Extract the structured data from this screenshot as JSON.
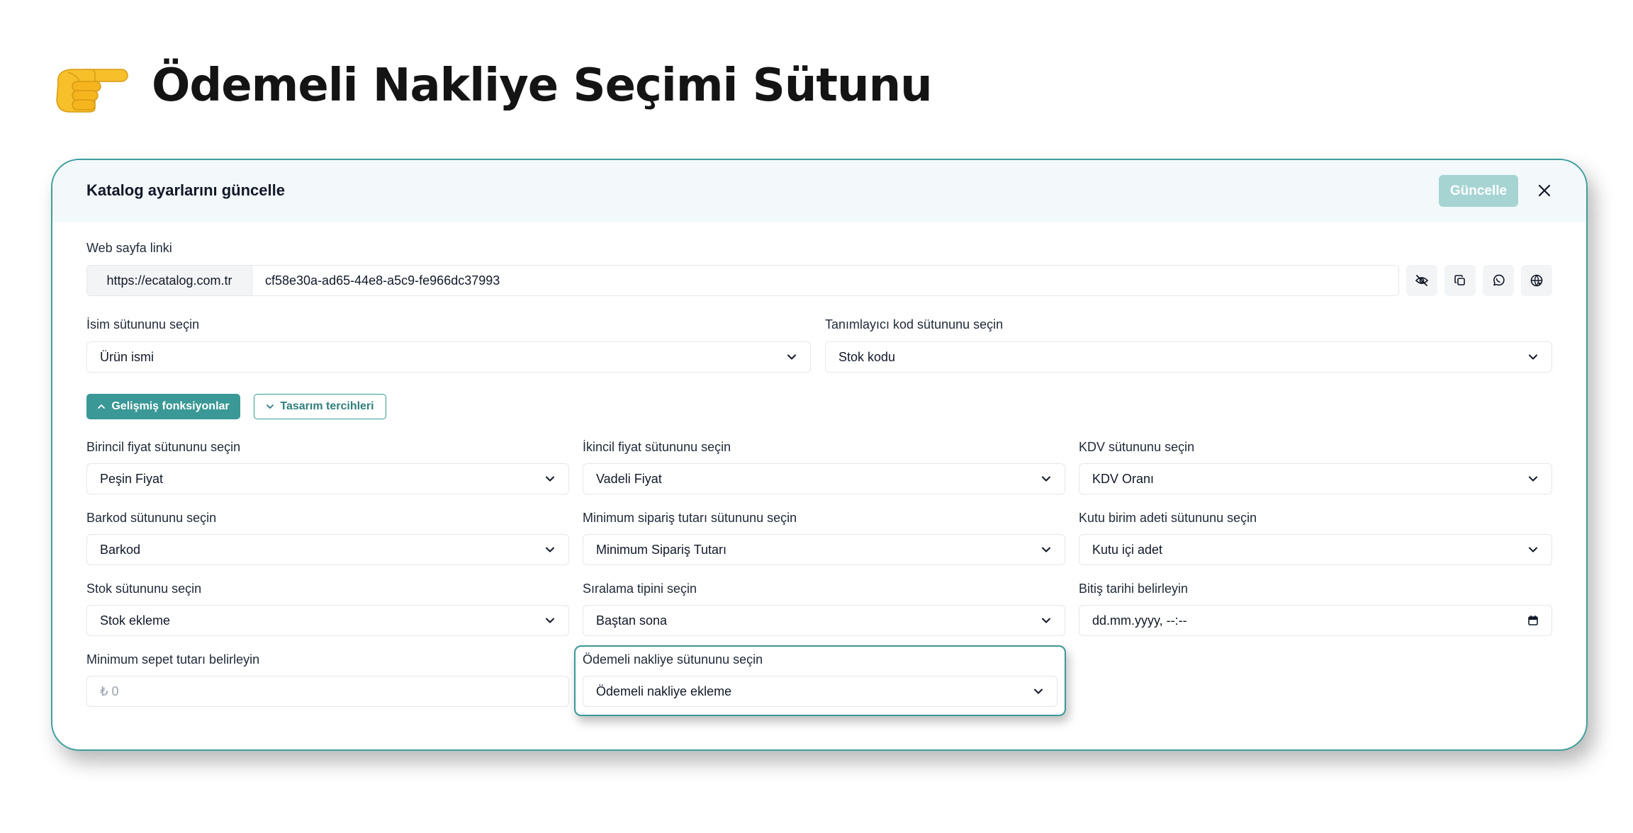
{
  "heading": {
    "icon": "pointing-hand-icon",
    "title": "Ödemeli Nakliye Seçimi Sütunu"
  },
  "dialog": {
    "title": "Katalog ayarlarını güncelle",
    "update_label": "Güncelle",
    "close_icon": "close-icon",
    "web_link": {
      "label": "Web sayfa linki",
      "prefix": "https://ecatalog.com.tr",
      "value": "cf58e30a-ad65-44e8-a5c9-fe966dc37993",
      "actions": [
        "eye-off-icon",
        "copy-icon",
        "whatsapp-icon",
        "globe-icon"
      ]
    },
    "name_column": {
      "label": "İsim sütununu seçin",
      "value": "Ürün ismi"
    },
    "id_column": {
      "label": "Tanımlayıcı kod sütununu seçin",
      "value": "Stok kodu"
    },
    "tabs": {
      "advanced": "Gelişmiş fonksiyonlar",
      "design": "Tasarım tercihleri"
    },
    "fields": {
      "primary_price": {
        "label": "Birincil fiyat sütununu seçin",
        "value": "Peşin Fiyat"
      },
      "secondary_price": {
        "label": "İkincil fiyat sütununu seçin",
        "value": "Vadeli Fiyat"
      },
      "vat": {
        "label": "KDV sütununu seçin",
        "value": "KDV Oranı"
      },
      "barcode": {
        "label": "Barkod sütununu seçin",
        "value": "Barkod"
      },
      "min_order": {
        "label": "Minimum sipariş tutarı sütununu seçin",
        "value": "Minimum Sipariş Tutarı"
      },
      "box_unit": {
        "label": "Kutu birim adeti sütununu seçin",
        "value": "Kutu içi adet"
      },
      "stock": {
        "label": "Stok sütununu seçin",
        "value": "Stok ekleme"
      },
      "sort": {
        "label": "Sıralama tipini seçin",
        "value": "Baştan sona"
      },
      "end_date": {
        "label": "Bitiş tarihi belirleyin",
        "placeholder": "dd.mm.yyyy, --:--"
      },
      "min_cart": {
        "label": "Minimum sepet tutarı belirleyin",
        "placeholder": "₺ 0"
      },
      "cod": {
        "label": "Ödemeli nakliye sütununu seçin",
        "value": "Ödemeli nakliye ekleme"
      }
    }
  },
  "colors": {
    "accent": "#3a9896",
    "accent_disabled": "#a6d4d3",
    "header_bg": "#f3f8fb"
  }
}
